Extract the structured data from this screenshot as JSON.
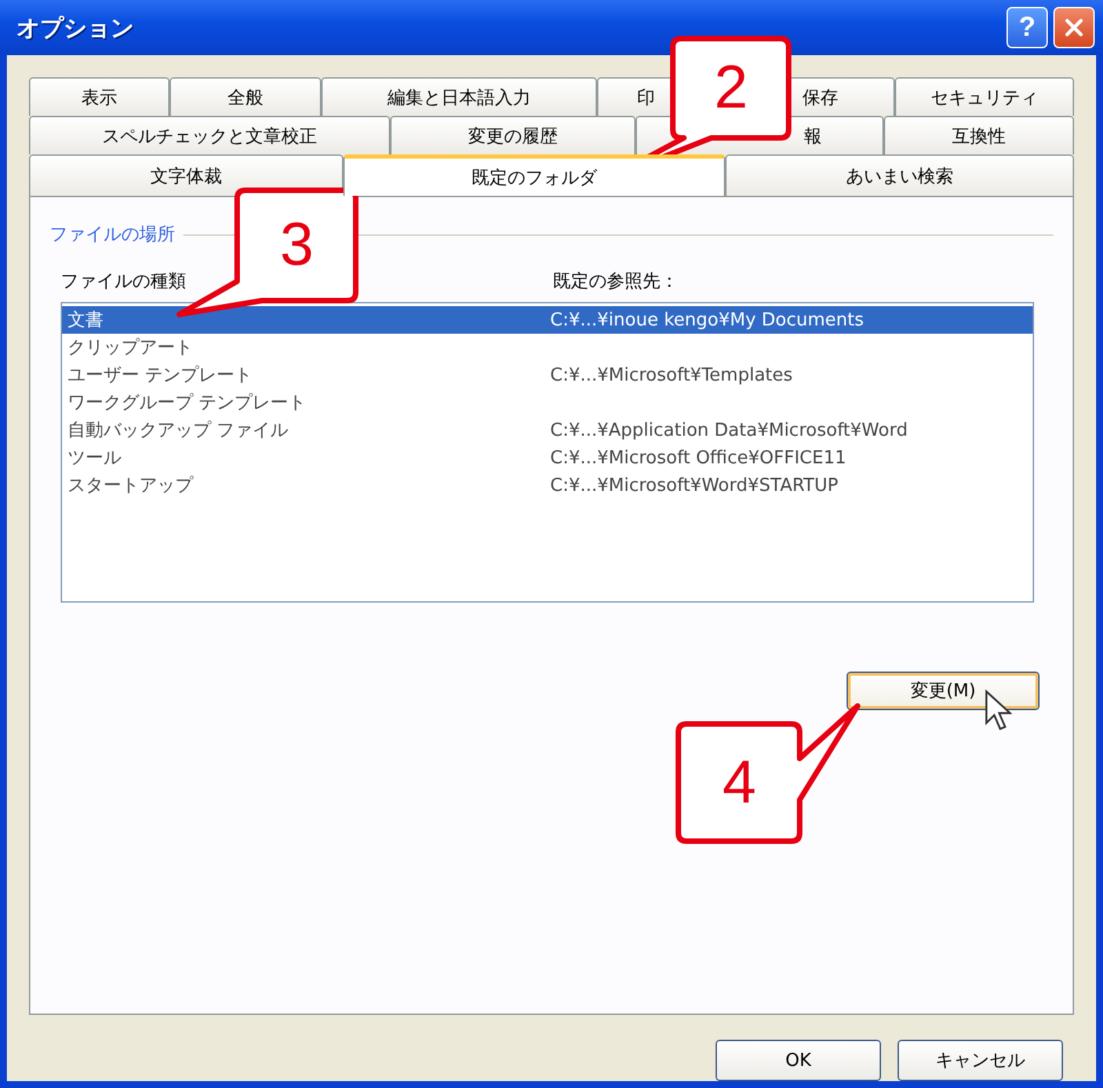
{
  "window": {
    "title": "オプション",
    "title_buttons": [
      {
        "kind": "help",
        "label": "?"
      },
      {
        "kind": "close"
      }
    ]
  },
  "tab_rows": [
    {
      "tabs": [
        {
          "label": "表示",
          "selected": false
        },
        {
          "label": "全般",
          "selected": false
        },
        {
          "label": "編集と日本語入力",
          "selected": false
        },
        {
          "label": "印",
          "selected": false
        },
        {
          "label": "保存",
          "selected": false
        },
        {
          "label": "セキュリティ",
          "selected": false
        }
      ]
    },
    {
      "tabs": [
        {
          "label": "スペルチェックと文章校正",
          "selected": false
        },
        {
          "label": "変更の履歴",
          "selected": false
        },
        {
          "label": "報",
          "selected": false
        },
        {
          "label": "互換性",
          "selected": false
        }
      ]
    },
    {
      "tabs": [
        {
          "label": "文字体裁",
          "selected": false
        },
        {
          "label": "既定のフォルダ",
          "selected": true
        },
        {
          "label": "あいまい検索",
          "selected": false
        }
      ]
    }
  ],
  "group": {
    "title": "ファイルの場所"
  },
  "list": {
    "columns": [
      "ファイルの種類",
      "既定の参照先："
    ],
    "rows": [
      {
        "type": "文書",
        "path": "C:¥...¥inoue kengo¥My Documents",
        "selected": true
      },
      {
        "type": "クリップアート",
        "selected": false
      },
      {
        "type": "ユーザー テンプレート",
        "path": "C:¥...¥Microsoft¥Templates",
        "selected": false
      },
      {
        "type": "ワークグループ テンプレート",
        "selected": false
      },
      {
        "type": "自動バックアップ ファイル",
        "path": "C:¥...¥Application Data¥Microsoft¥Word",
        "selected": false
      },
      {
        "type": "ツール",
        "path": "C:¥...¥Microsoft Office¥OFFICE11",
        "selected": false
      },
      {
        "type": "スタートアップ",
        "path": "C:¥...¥Microsoft¥Word¥STARTUP",
        "selected": false
      }
    ]
  },
  "modify_button": {
    "label": "変更(M)"
  },
  "buttons": [
    "OK",
    "キャンセル"
  ],
  "callouts": [
    {
      "number": "2"
    },
    {
      "number": "3"
    },
    {
      "number": "4"
    }
  ]
}
